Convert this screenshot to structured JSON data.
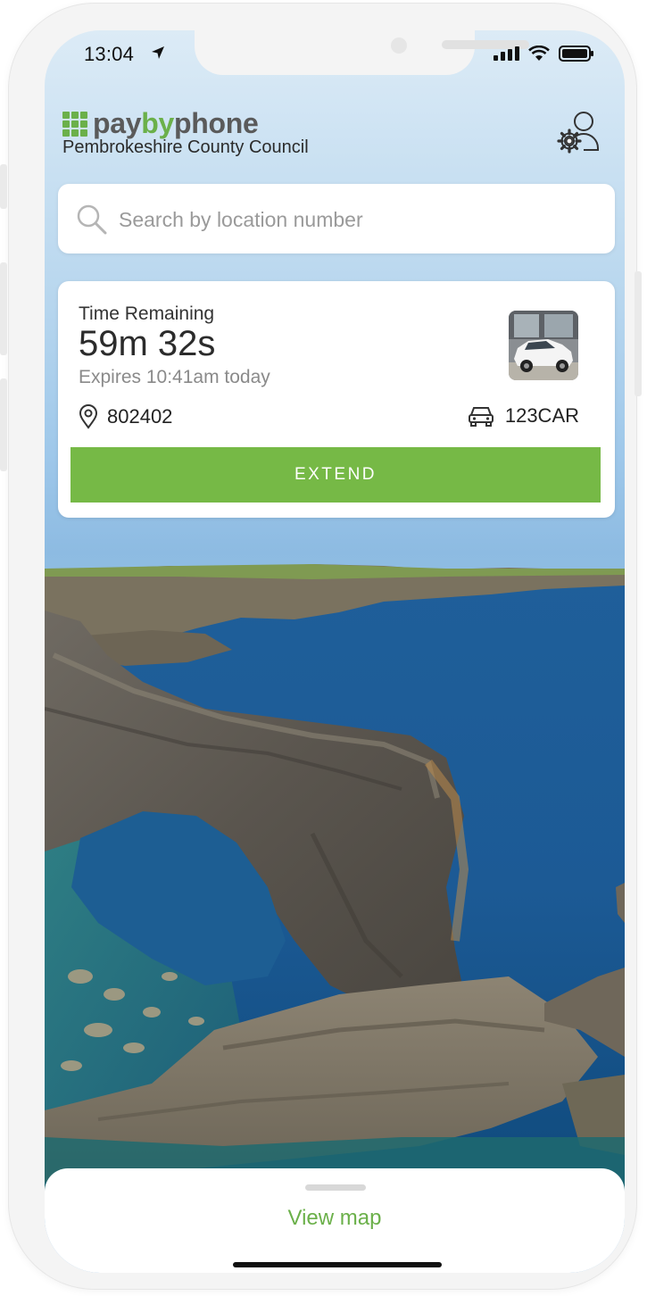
{
  "status_bar": {
    "time": "13:04"
  },
  "header": {
    "logo_pay": "pay",
    "logo_by": "by",
    "logo_phone": "phone",
    "council": "Pembrokeshire County Council"
  },
  "search": {
    "placeholder": "Search by location number"
  },
  "session": {
    "label": "Time Remaining",
    "remaining": "59m 32s",
    "expires": "Expires 10:41am today",
    "location_number": "802402",
    "vehicle_plate": "123CAR",
    "extend_label": "EXTEND"
  },
  "bottom_sheet": {
    "view_map_label": "View map"
  },
  "colors": {
    "brand_green": "#6bb04a",
    "extend_green": "#76b946"
  },
  "icons": {
    "search": "search-icon",
    "settings": "account-settings-icon",
    "location": "location-pin-icon",
    "vehicle": "car-icon",
    "status_location": "location-arrow-icon"
  }
}
